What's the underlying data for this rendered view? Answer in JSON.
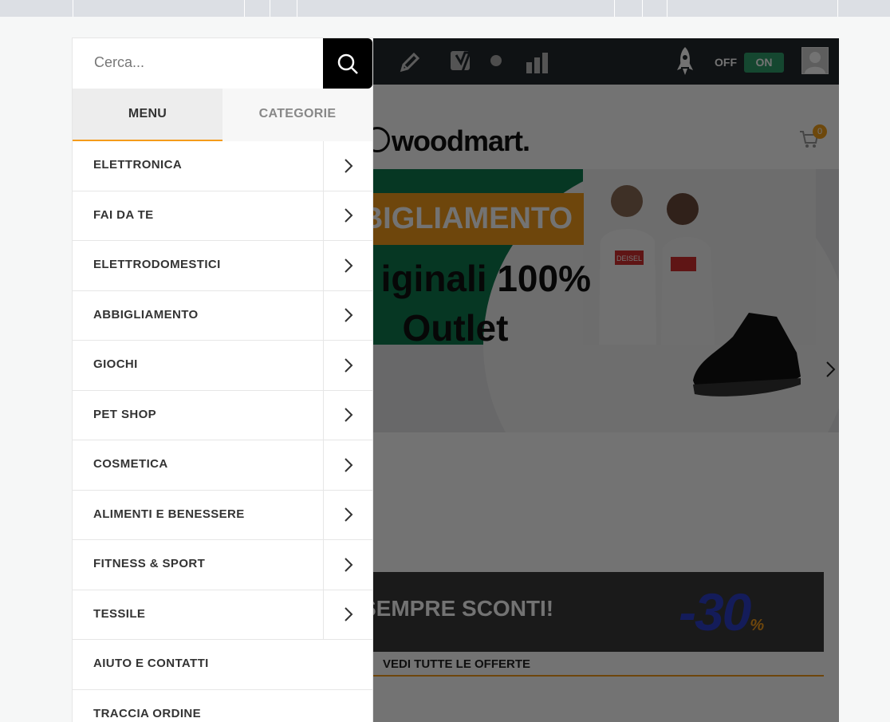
{
  "menu_panel": {
    "search_placeholder": "Cerca...",
    "tabs": [
      {
        "label": "MENU",
        "active": true
      },
      {
        "label": "CATEGORIE",
        "active": false
      }
    ],
    "items": [
      {
        "label": "ELETTRONICA",
        "has_submenu": true
      },
      {
        "label": "FAI DA TE",
        "has_submenu": true
      },
      {
        "label": "ELETTRODOMESTICI",
        "has_submenu": true
      },
      {
        "label": "ABBIGLIAMENTO",
        "has_submenu": true
      },
      {
        "label": "GIOCHI",
        "has_submenu": true
      },
      {
        "label": "PET SHOP",
        "has_submenu": true
      },
      {
        "label": "COSMETICA",
        "has_submenu": true
      },
      {
        "label": "ALIMENTI E BENESSERE",
        "has_submenu": true
      },
      {
        "label": "FITNESS & SPORT",
        "has_submenu": true
      },
      {
        "label": "TESSILE",
        "has_submenu": true
      },
      {
        "label": "AIUTO E CONTATTI",
        "has_submenu": false
      },
      {
        "label": "TRACCIA ORDINE",
        "has_submenu": false
      }
    ]
  },
  "admin_bar": {
    "toggle_off": "OFF",
    "toggle_on": "ON",
    "icons": [
      "edit-icon",
      "yoast-icon",
      "status-dot-icon",
      "stats-icon",
      "rocket-icon",
      "avatar"
    ]
  },
  "site": {
    "logo_text": "woodmart.",
    "cart_count": "0",
    "slide": {
      "badge": "BIGLIAMENTO",
      "line1": "iginali 100%",
      "line2": "Outlet",
      "brand_shirt": "DEISEL"
    },
    "promo": {
      "text": "SEMPRE SCONTI!",
      "discount": "-30",
      "percent": "%"
    },
    "offers_link": "VEDI TUTTE LE OFFERTE"
  },
  "colors": {
    "accent": "#f49b1b",
    "admin_bar": "#23282d",
    "toggle_on": "#2f9e6b"
  }
}
